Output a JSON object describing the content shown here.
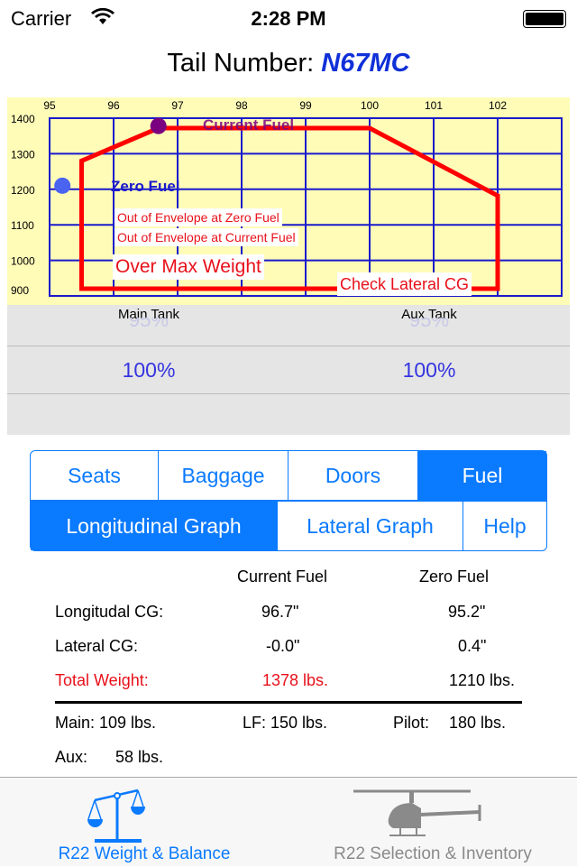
{
  "status": {
    "carrier": "Carrier",
    "time": "2:28 PM",
    "wifi_icon": "wifi-icon",
    "battery_icon": "battery-icon"
  },
  "header": {
    "label": "Tail Number:",
    "tail": "N67MC"
  },
  "chart_data": {
    "type": "line",
    "x_ticks": [
      95,
      96,
      97,
      98,
      99,
      100,
      101,
      102
    ],
    "y_ticks": [
      900,
      1000,
      1100,
      1200,
      1300,
      1400
    ],
    "xlim": [
      95,
      103
    ],
    "ylim": [
      900,
      1400
    ],
    "grid": true,
    "envelope": [
      [
        95.5,
        900
      ],
      [
        95.5,
        1280
      ],
      [
        96.7,
        1372
      ],
      [
        100,
        1372
      ],
      [
        102,
        1182
      ],
      [
        102,
        900
      ]
    ],
    "points": [
      {
        "name": "Current Fuel",
        "x": 96.7,
        "y": 1378,
        "color": "#7a0080"
      },
      {
        "name": "Zero Fuel",
        "x": 95.2,
        "y": 1210,
        "color": "#4a63f0"
      }
    ],
    "colors": {
      "background": "#fffcb8",
      "grid": "#1a1acc",
      "envelope": "#ff0000"
    }
  },
  "warnings": {
    "zero": "Out of Envelope at Zero Fuel",
    "current": "Out of Envelope at Current Fuel",
    "max": "Over Max Weight",
    "lateral": "Check Lateral CG"
  },
  "tanks": {
    "main": {
      "label": "Main Tank",
      "prev": "95%",
      "value": "100%"
    },
    "aux": {
      "label": "Aux Tank",
      "prev": "95%",
      "value": "100%"
    }
  },
  "seg1": [
    "Seats",
    "Baggage",
    "Doors",
    "Fuel"
  ],
  "seg2": [
    "Longitudinal Graph",
    "Lateral Graph",
    "Help"
  ],
  "table": {
    "col_current": "Current Fuel",
    "col_zero": "Zero Fuel",
    "rows": [
      {
        "label": "Longitudal CG:",
        "current": "96.7\"",
        "zero": "95.2\""
      },
      {
        "label": "Lateral CG:",
        "current": "-0.0\"",
        "zero": "0.4\""
      },
      {
        "label": "Total Weight:",
        "current": "1378 lbs.",
        "zero": "1210 lbs."
      }
    ],
    "main": "Main: 109 lbs.",
    "lf": "LF: 150 lbs.",
    "pilot_label": "Pilot:",
    "pilot": "180 lbs.",
    "aux_label": "Aux:",
    "aux": "58 lbs."
  },
  "tabbar": [
    {
      "label": "R22 Weight & Balance",
      "icon": "scale-icon",
      "active": true
    },
    {
      "label": "R22 Selection & Inventory",
      "icon": "helicopter-icon",
      "active": false
    }
  ]
}
